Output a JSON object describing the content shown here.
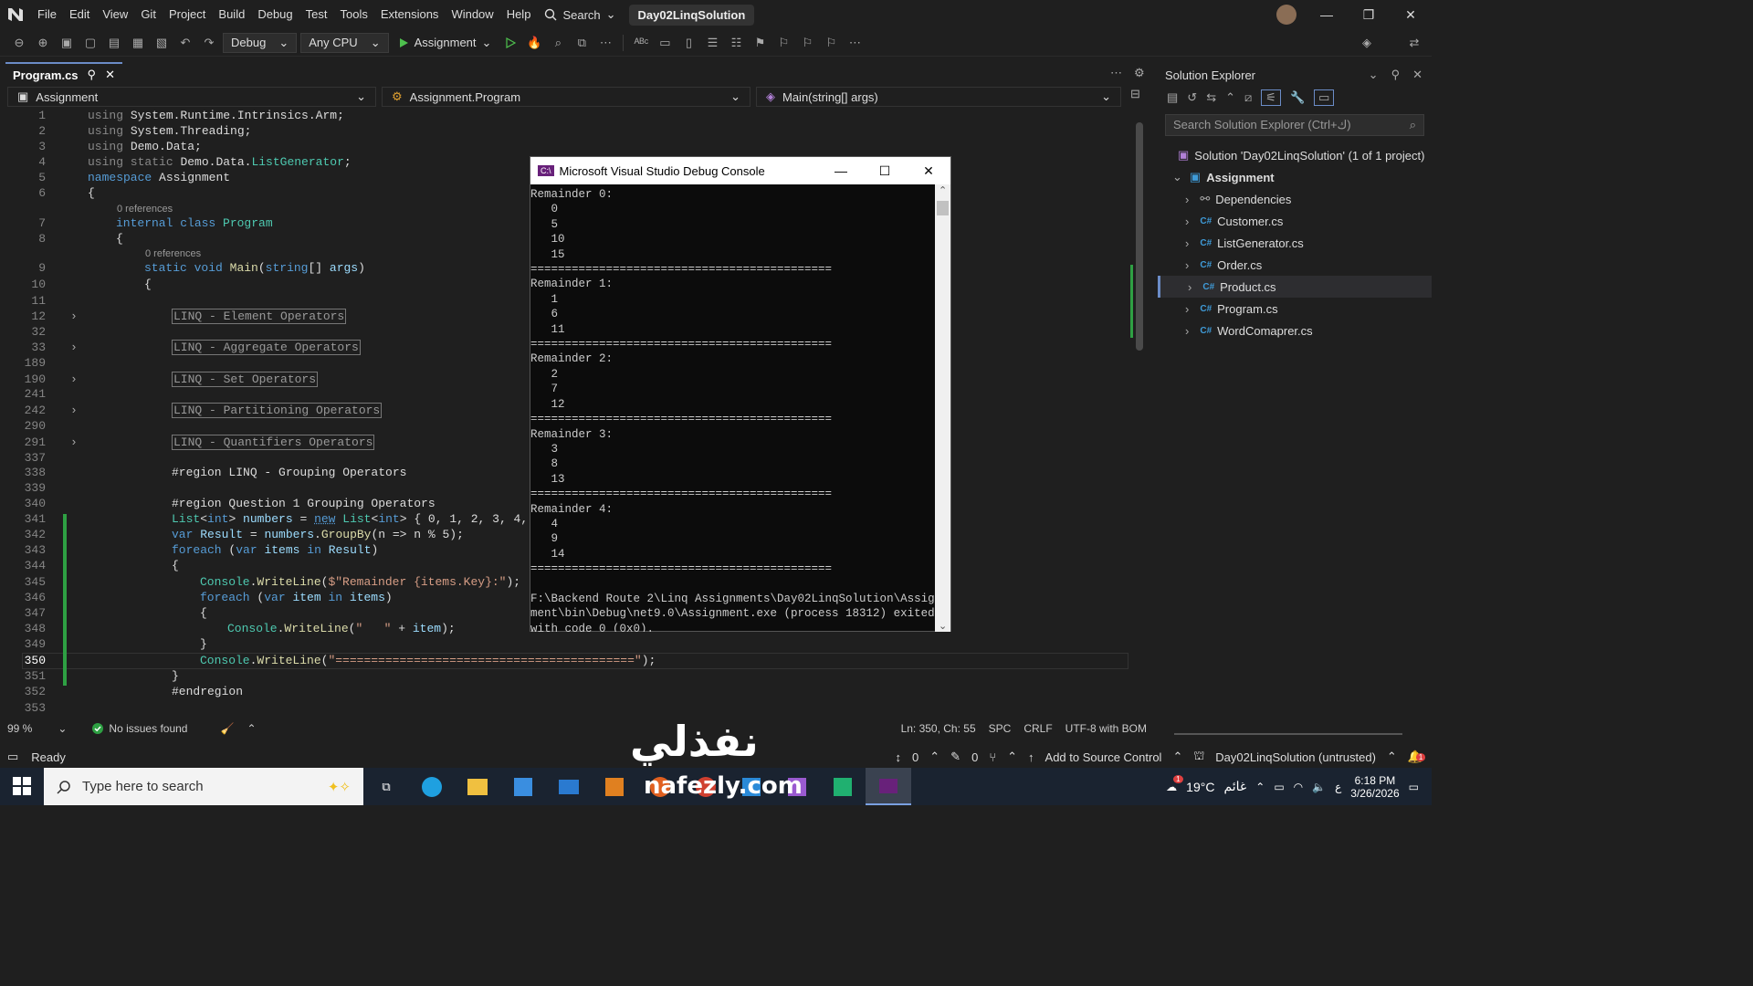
{
  "menubar": {
    "items": [
      "File",
      "Edit",
      "View",
      "Git",
      "Project",
      "Build",
      "Debug",
      "Test",
      "Tools",
      "Extensions",
      "Window",
      "Help"
    ],
    "search_label": "Search",
    "solution_title": "Day02LinqSolution"
  },
  "toolbar": {
    "config": "Debug",
    "platform": "Any CPU",
    "run_target": "Assignment"
  },
  "tab": {
    "name": "Program.cs"
  },
  "nav": {
    "project": "Assignment",
    "class": "Assignment.Program",
    "member": "Main(string[] args)"
  },
  "refs": {
    "class_refs": "0 references",
    "main_refs": "0 references"
  },
  "regions": {
    "element": "LINQ - Element Operators",
    "aggregate": "LINQ - Aggregate Operators",
    "set": "LINQ - Set Operators",
    "partitioning": "LINQ - Partitioning Operators",
    "quantifiers": "LINQ - Quantifiers Operators"
  },
  "line_numbers": [
    "1",
    "2",
    "3",
    "4",
    "5",
    "6",
    "7",
    "8",
    "9",
    "10",
    "11",
    "12",
    "32",
    "33",
    "189",
    "190",
    "241",
    "242",
    "290",
    "291",
    "337",
    "338",
    "339",
    "340",
    "341",
    "342",
    "343",
    "344",
    "345",
    "346",
    "347",
    "348",
    "349",
    "350",
    "351",
    "352",
    "353"
  ],
  "code": {
    "l1_ns": "System.Runtime.Intrinsics.Arm;",
    "l2_ns": "System.Threading;",
    "l3_ns": "Demo.Data;",
    "l4_ns": "Demo.Data.",
    "l4_type": "ListGenerator",
    "l5_name": "Assignment",
    "l7_name": "Program",
    "l9_main": "Main",
    "l9_args": "args",
    "l338": "#region LINQ - Grouping Operators",
    "l340": "#region Question 1 Grouping Operators",
    "l341_rest": "{ 0, 1, 2, 3, 4,",
    "l342_rest": "(n => n % 5);",
    "l345_str": "$\"Remainder {items.Key}:\"",
    "l348_str": "\"   \"",
    "l350_str": "\"==========================================\"",
    "l352": "#endregion"
  },
  "console": {
    "title": "Microsoft Visual Studio Debug Console",
    "output": "Remainder 0:\n   0\n   5\n   10\n   15\n============================================\nRemainder 1:\n   1\n   6\n   11\n============================================\nRemainder 2:\n   2\n   7\n   12\n============================================\nRemainder 3:\n   3\n   8\n   13\n============================================\nRemainder 4:\n   4\n   9\n   14\n============================================\n\nF:\\Backend Route 2\\Linq Assignments\\Day02LinqSolution\\Assign\nment\\bin\\Debug\\net9.0\\Assignment.exe (process 18312) exited\nwith code 0 (0x0)."
  },
  "solution_explorer": {
    "title": "Solution Explorer",
    "search_placeholder": "Search Solution Explorer (Ctrl+ك)",
    "solution": "Solution 'Day02LinqSolution' (1 of 1 project)",
    "project": "Assignment",
    "items": [
      "Dependencies",
      "Customer.cs",
      "ListGenerator.cs",
      "Order.cs",
      "Product.cs",
      "Program.cs",
      "WordComaprer.cs"
    ],
    "selected": "Product.cs"
  },
  "editor_status": {
    "zoom": "99 %",
    "issues": "No issues found",
    "position": "Ln: 350, Ch: 55",
    "whitespace": "SPC",
    "line_ending": "CRLF",
    "encoding": "UTF-8 with BOM"
  },
  "statusbar": {
    "state": "Ready",
    "up_count": "0",
    "edit_count": "0",
    "source_control": "Add to Source Control",
    "repo": "Day02LinqSolution (untrusted)",
    "notif_count": "1"
  },
  "taskbar": {
    "search_placeholder": "Type here to search",
    "weather": "19°C",
    "weather_desc": "غائم",
    "lang": "ع",
    "time": "6:18 PM",
    "date": "3/26/2026",
    "weather_badge": "1"
  },
  "watermark": "نفذلي",
  "watermark_url": "nafezly.com",
  "colors": {
    "accent": "#6b8cc7",
    "keyword": "#569cd6",
    "type": "#4ec9b0",
    "method": "#dcdcaa",
    "string": "#d69d85"
  }
}
